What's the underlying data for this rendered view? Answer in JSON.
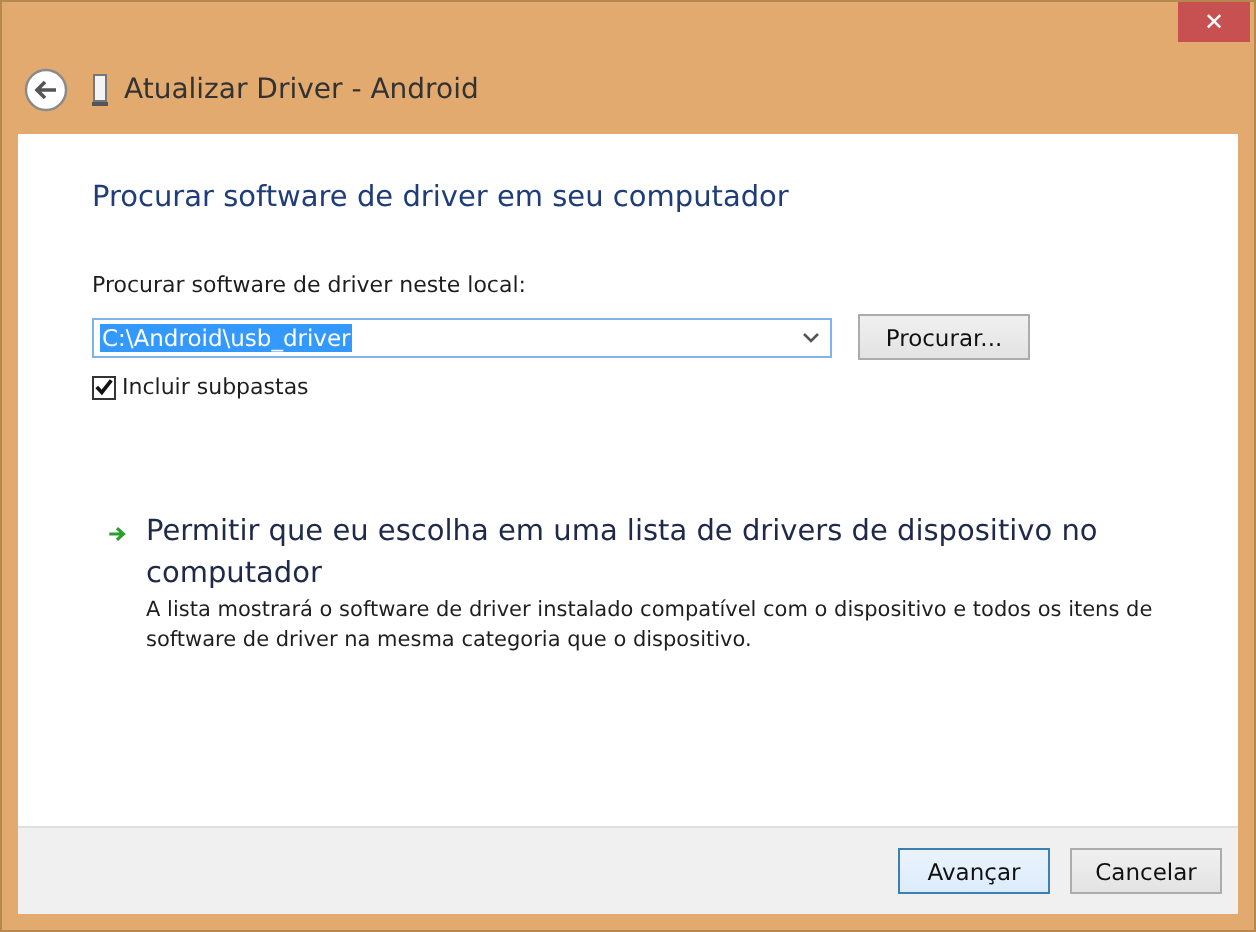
{
  "window": {
    "title": "Atualizar Driver -  Android",
    "close": "✕"
  },
  "heading": "Procurar software de driver em seu computador",
  "location": {
    "label": "Procurar software de driver neste local:",
    "value": "C:\\Android\\usb_driver",
    "value_selected": true,
    "browse": "Procurar..."
  },
  "include_subfolders": {
    "label": "Incluir subpastas",
    "checked": true
  },
  "option": {
    "title": "Permitir que eu escolha em uma lista de drivers de dispositivo no computador",
    "description": "A lista mostrará o software de driver instalado compatível com o dispositivo e todos os itens de software de driver na mesma categoria que o dispositivo."
  },
  "buttons": [
    {
      "label": "Avançar",
      "default": true
    },
    {
      "label": "Cancelar",
      "default": false
    }
  ]
}
